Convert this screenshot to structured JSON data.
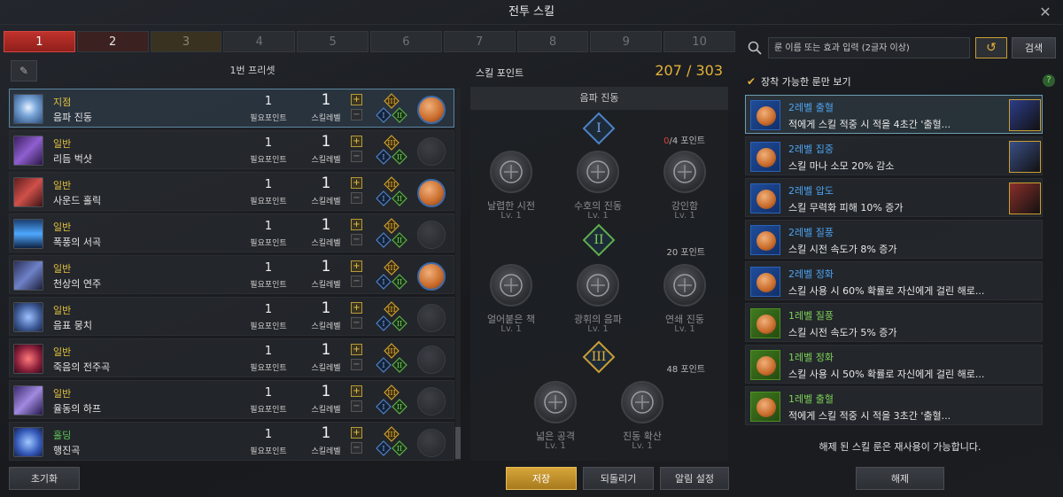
{
  "window": {
    "title": "전투 스킬"
  },
  "tabs": [
    "1",
    "2",
    "3",
    "4",
    "5",
    "6",
    "7",
    "8",
    "9",
    "10"
  ],
  "preset": {
    "title": "1번 프리셋"
  },
  "skills": [
    {
      "type": "지점",
      "name": "음파 진동",
      "points": "1",
      "point_label": "필요포인트",
      "level": "1",
      "level_label": "스킬레벨",
      "rune": true
    },
    {
      "type": "일반",
      "name": "리듬 벅샷",
      "points": "1",
      "point_label": "필요포인트",
      "level": "1",
      "level_label": "스킬레벨",
      "rune": false
    },
    {
      "type": "일반",
      "name": "사운드 홀릭",
      "points": "1",
      "point_label": "필요포인트",
      "level": "1",
      "level_label": "스킬레벨",
      "rune": true
    },
    {
      "type": "일반",
      "name": "폭풍의 서곡",
      "points": "1",
      "point_label": "필요포인트",
      "level": "1",
      "level_label": "스킬레벨",
      "rune": false
    },
    {
      "type": "일반",
      "name": "천상의 연주",
      "points": "1",
      "point_label": "필요포인트",
      "level": "1",
      "level_label": "스킬레벨",
      "rune": true
    },
    {
      "type": "일반",
      "name": "음표 뭉치",
      "points": "1",
      "point_label": "필요포인트",
      "level": "1",
      "level_label": "스킬레벨",
      "rune": false
    },
    {
      "type": "일반",
      "name": "죽음의 전주곡",
      "points": "1",
      "point_label": "필요포인트",
      "level": "1",
      "level_label": "스킬레벨",
      "rune": false
    },
    {
      "type": "일반",
      "name": "율동의 하프",
      "points": "1",
      "point_label": "필요포인트",
      "level": "1",
      "level_label": "스킬레벨",
      "rune": false
    },
    {
      "type": "홀딩",
      "name": "행진곡",
      "points": "1",
      "point_label": "필요포인트",
      "level": "1",
      "level_label": "스킬레벨",
      "rune": false
    }
  ],
  "buttons": {
    "reset": "초기화",
    "save": "저장",
    "revert": "되돌리기",
    "notify": "알림 설정",
    "search": "검색",
    "release": "해제"
  },
  "skill_points": {
    "label": "스킬 포인트",
    "value": "207 / 303"
  },
  "tree": {
    "title": "음파 진동",
    "tiers": [
      {
        "numeral": "I",
        "req_used": "0",
        "req_rest": "/4 포인트",
        "nodes": [
          {
            "name": "날렵한 시전",
            "lv": "Lv. 1"
          },
          {
            "name": "수호의 진동",
            "lv": "Lv. 1"
          },
          {
            "name": "강인함",
            "lv": "Lv. 1"
          }
        ]
      },
      {
        "numeral": "II",
        "req": "20 포인트",
        "nodes": [
          {
            "name": "얼어붙은 책",
            "lv": "Lv. 1"
          },
          {
            "name": "광휘의 음파",
            "lv": "Lv. 1"
          },
          {
            "name": "연쇄 진동",
            "lv": "Lv. 1"
          }
        ]
      },
      {
        "numeral": "III",
        "req": "48 포인트",
        "nodes": [
          {
            "name": "넓은 공격",
            "lv": "Lv. 1"
          },
          {
            "name": "진동 확산",
            "lv": "Lv. 1"
          }
        ]
      }
    ]
  },
  "search": {
    "placeholder": "룬 이름 또는 효과 입력 (2글자 이상)"
  },
  "filter": {
    "label": "장착 가능한 룬만 보기",
    "checked": true
  },
  "runes": [
    {
      "name": "2레벨 출혈",
      "desc": "적에게 스킬 적중 시 적을 4초간 '출혈...",
      "grade": "blue",
      "equipped": "#2d3d8a"
    },
    {
      "name": "2레벨 집중",
      "desc": "스킬 마나 소모 20% 감소",
      "grade": "blue",
      "equipped": "#3a4f86"
    },
    {
      "name": "2레벨 압도",
      "desc": "스킬 무력화 피해 10% 증가",
      "grade": "blue",
      "equipped": "#8a2f2a"
    },
    {
      "name": "2레벨 질풍",
      "desc": "스킬 시전 속도가 8% 증가",
      "grade": "blue"
    },
    {
      "name": "2레벨 정화",
      "desc": "스킬 사용 시 60% 확률로 자신에게 걸린 해로...",
      "grade": "blue"
    },
    {
      "name": "1레벨 질풍",
      "desc": "스킬 시전 속도가 5% 증가",
      "grade": "green"
    },
    {
      "name": "1레벨 정화",
      "desc": "스킬 사용 시 50% 확률로 자신에게 걸린 해로...",
      "grade": "green"
    },
    {
      "name": "1레벨 출혈",
      "desc": "적에게 스킬 적중 시 적을 3초간 '출혈...",
      "grade": "green"
    }
  ],
  "reuse_note": "해제 된 스킬 룬은 재사용이 가능합니다.",
  "icons": {
    "close": "close-icon",
    "edit": "pencil-icon",
    "search": "search-icon",
    "refresh": "refresh-icon",
    "help": "help-icon",
    "check": "checkmark-icon"
  },
  "colors": {
    "accent_gold": "#e5b236",
    "tab_active": "#c0322c",
    "rune_blue": "#4ea3f0",
    "rune_green": "#7ed257",
    "skill_type_yellow": "#e3c33f",
    "skill_type_green": "#5ec95a"
  }
}
